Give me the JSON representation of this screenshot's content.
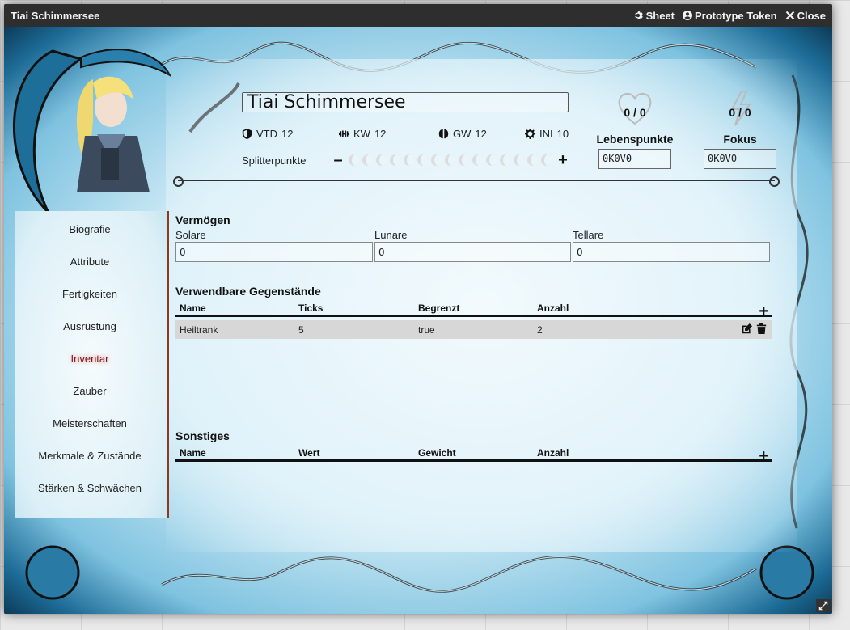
{
  "window": {
    "title": "Tiai Schimmersee",
    "controls": {
      "sheet": "Sheet",
      "prototype": "Prototype Token",
      "close": "Close"
    }
  },
  "character": {
    "name": "Tiai Schimmersee",
    "stats": [
      {
        "key": "vtd",
        "label": "VTD",
        "value": "12",
        "icon": "shield-icon"
      },
      {
        "key": "kw",
        "label": "KW",
        "value": "12",
        "icon": "dumbbell-icon"
      },
      {
        "key": "gw",
        "label": "GW",
        "value": "12",
        "icon": "brain-icon"
      },
      {
        "key": "ini",
        "label": "INI",
        "value": "10",
        "icon": "cog-icon"
      }
    ],
    "splitterpunkte": {
      "label": "Splitterpunkte",
      "minus": "–",
      "plus": "+",
      "moons": 15
    },
    "lebenspunkte": {
      "value": "0 / 0",
      "label": "Lebenspunkte",
      "field": "0K0V0",
      "icon": "heart-icon"
    },
    "fokus": {
      "value": "0 / 0",
      "label": "Fokus",
      "field": "0K0V0",
      "icon": "lightning-icon"
    }
  },
  "sidebar": {
    "items": [
      {
        "label": "Biografie",
        "active": false
      },
      {
        "label": "Attribute",
        "active": false
      },
      {
        "label": "Fertigkeiten",
        "active": false
      },
      {
        "label": "Ausrüstung",
        "active": false
      },
      {
        "label": "Inventar",
        "active": true
      },
      {
        "label": "Zauber",
        "active": false
      },
      {
        "label": "Meisterschaften",
        "active": false
      },
      {
        "label": "Merkmale & Zustände",
        "active": false
      },
      {
        "label": "Stärken & Schwächen",
        "active": false
      }
    ]
  },
  "inventar": {
    "vermoegen": {
      "title": "Vermögen",
      "fields": [
        {
          "label": "Solare",
          "value": "0"
        },
        {
          "label": "Lunare",
          "value": "0"
        },
        {
          "label": "Tellare",
          "value": "0"
        }
      ]
    },
    "verwendbar": {
      "title": "Verwendbare Gegenstände",
      "columns": [
        "Name",
        "Ticks",
        "Begrenzt",
        "Anzahl"
      ],
      "rows": [
        {
          "name": "Heiltrank",
          "ticks": "5",
          "begrenzt": "true",
          "anzahl": "2"
        }
      ],
      "add": "+"
    },
    "sonstiges": {
      "title": "Sonstiges",
      "columns": [
        "Name",
        "Wert",
        "Gewicht",
        "Anzahl"
      ],
      "add": "+"
    }
  },
  "colors": {
    "accent": "#8c3a1e",
    "titlebar": "#2e2e2e",
    "frame": "#1d6c97"
  }
}
